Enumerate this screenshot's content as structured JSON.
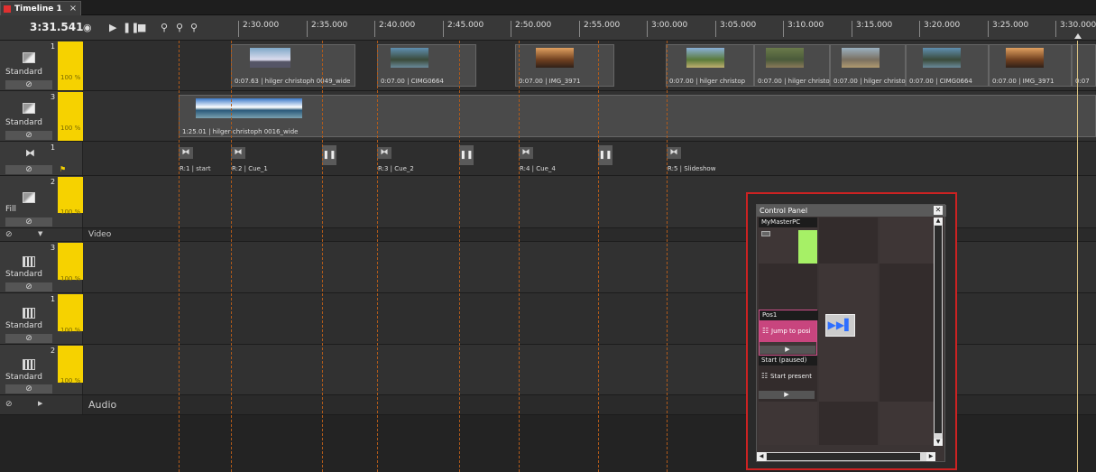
{
  "tab": {
    "label": "Timeline 1",
    "close": "×"
  },
  "toolbar": {
    "timecode": "3:31.541",
    "icons": [
      "eye-icon",
      "play-icon",
      "pause-icon",
      "stop-icon",
      "zoom-fit-icon",
      "zoom-out-icon",
      "zoom-in-icon"
    ]
  },
  "ruler": {
    "ticks": [
      "2:30.000",
      "2:35.000",
      "2:40.000",
      "2:45.000",
      "2:50.000",
      "2:55.000",
      "3:00.000",
      "3:05.000",
      "3:10.000",
      "3:15.000",
      "3:20.000",
      "3:25.000",
      "3:30.000"
    ]
  },
  "tracks": [
    {
      "num": "1",
      "type": "image",
      "label": "Standard",
      "pct": "100 %"
    },
    {
      "num": "3",
      "type": "image",
      "label": "Standard",
      "pct": "100 %"
    },
    {
      "num": "1",
      "type": "cue",
      "label": ""
    },
    {
      "num": "2",
      "type": "image",
      "label": "Fill",
      "pct": "100 %"
    },
    {
      "num": "",
      "type": "section",
      "label": "Video"
    },
    {
      "num": "3",
      "type": "video",
      "label": "Standard",
      "pct": "100 %"
    },
    {
      "num": "1",
      "type": "video",
      "label": "Standard",
      "pct": "100 %"
    },
    {
      "num": "2",
      "type": "video",
      "label": "Standard",
      "pct": "100 %"
    },
    {
      "num": "",
      "type": "section",
      "label": "Audio"
    }
  ],
  "clips_track1": [
    "0:07.63 | hilger christoph 0049_wide",
    "0:07.00 | CIMG0664",
    "0:07.00 | IMG_3971",
    "0:07.00 | hilger christop",
    "0:07.00 | hilger christop",
    "0:07.00 | hilger christop",
    "0:07.00 | CIMG0664",
    "0:07.00 | IMG_3971",
    "0:07"
  ],
  "clip_track2": "1:25.01 | hilger christoph 0016_wide",
  "cues": [
    "R:1 | start",
    "R:2 | Cue_1",
    "R:3 | Cue_2",
    "R:4 | Cue_4",
    "R:5 | Slideshow"
  ],
  "control_panel": {
    "title": "Control Panel",
    "close": "✕",
    "items": [
      {
        "name": "MyMasterPC",
        "button": ""
      },
      {
        "name": "Pos1",
        "button": "Jump to posi",
        "play": "▶"
      },
      {
        "name": "Start (paused)",
        "button": "Start present",
        "play": "▶"
      }
    ]
  },
  "colors": {
    "accent_yellow": "#f6d200",
    "record_red": "#e03030",
    "highlight_pink": "#d0508a",
    "panel_border": "#cc2222",
    "skip_blue": "#2e6fff"
  }
}
